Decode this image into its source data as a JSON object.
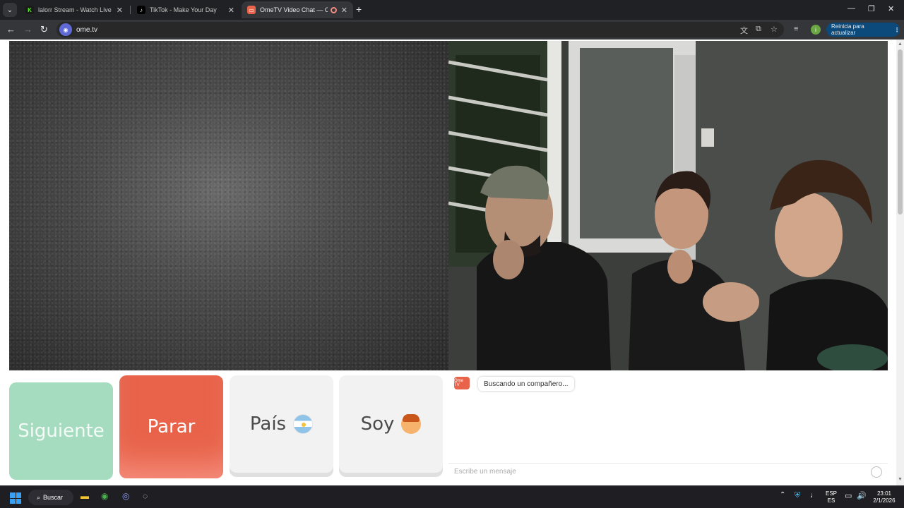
{
  "browser": {
    "tabs": [
      {
        "title": "lalorr Stream - Watch Live on K",
        "favicon": "kick-icon",
        "active": false
      },
      {
        "title": "TikTok - Make Your Day",
        "favicon": "tiktok-icon",
        "active": false
      },
      {
        "title": "OmeTV Video Chat — Ome",
        "favicon": "ometv-icon",
        "active": true
      }
    ],
    "url": "ome.tv",
    "update_button": "Reinicia para actualizar",
    "profile_initial": "i"
  },
  "page": {
    "buttons": {
      "next": "Siguiente",
      "stop": "Parar",
      "country": "País",
      "gender": "Soy"
    },
    "chat": {
      "logo_text": "Ome TV",
      "status_message": "Buscando un compañero...",
      "input_placeholder": "Escribe un mensaje"
    },
    "colors": {
      "next": "#a5dbbf",
      "stop": "#e8634a",
      "neutral": "#f2f2f2"
    }
  },
  "taskbar": {
    "search_label": "Buscar",
    "language": "ESP",
    "language_sub": "ES",
    "time": "23:01",
    "date": "2/1/2026"
  }
}
